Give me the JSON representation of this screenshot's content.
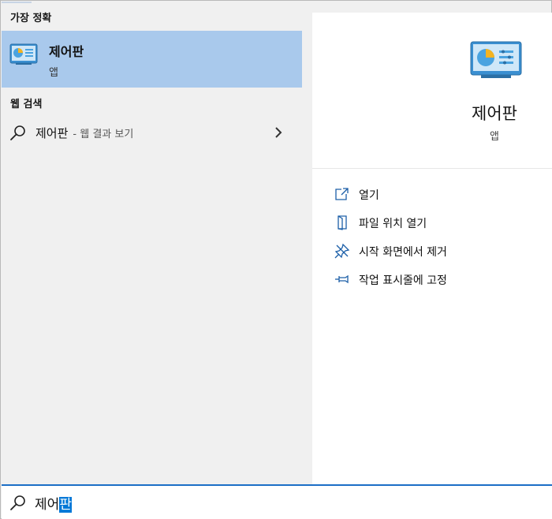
{
  "sections": {
    "best_match": "가장 정확",
    "web_search": "웹 검색"
  },
  "best_match_item": {
    "title": "제어판",
    "subtitle": "앱",
    "icon": "control-panel-icon"
  },
  "web_result": {
    "query": "제어판",
    "suffix": "- 웹 결과 보기",
    "icon": "search-icon"
  },
  "preview": {
    "title": "제어판",
    "subtitle": "앱",
    "actions": [
      {
        "label": "열기",
        "icon": "open-icon"
      },
      {
        "label": "파일 위치 열기",
        "icon": "file-location-icon"
      },
      {
        "label": "시작 화면에서 제거",
        "icon": "unpin-start-icon"
      },
      {
        "label": "작업 표시줄에 고정",
        "icon": "pin-taskbar-icon"
      }
    ]
  },
  "search": {
    "typed": "제어",
    "selected": "판"
  },
  "colors": {
    "accent": "#0078d7",
    "highlight": "#a9c9ec"
  }
}
